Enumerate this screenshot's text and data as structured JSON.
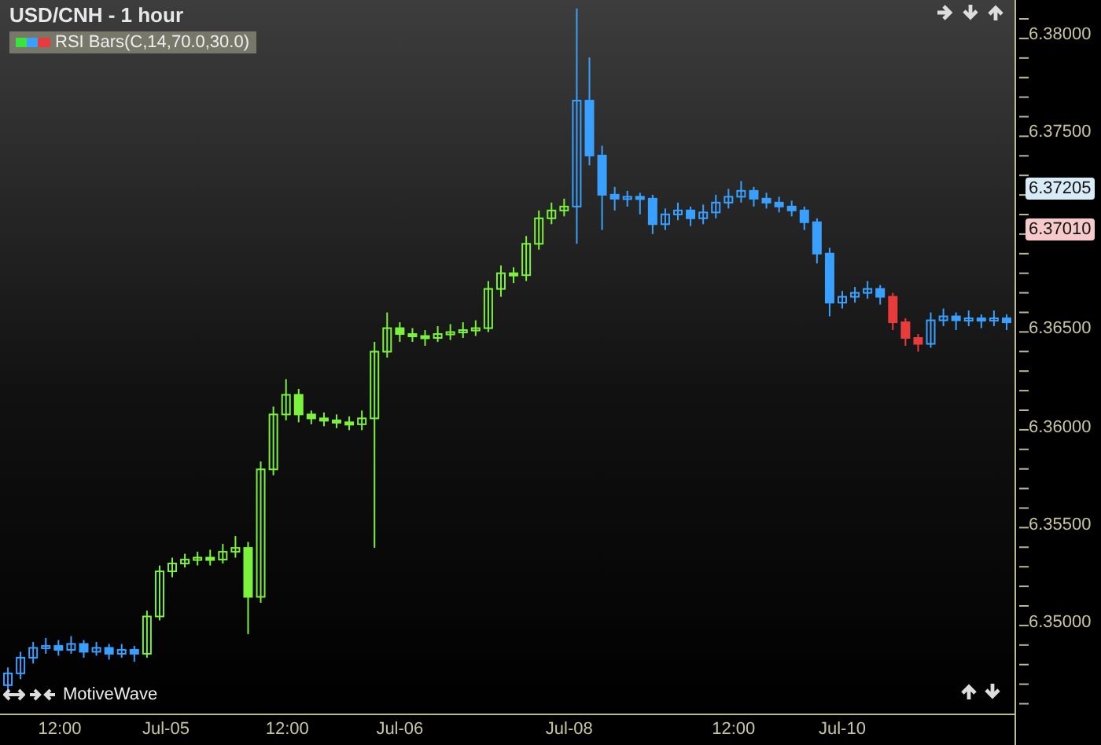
{
  "chart": {
    "title": "USD/CNH - 1 hour",
    "indicator": "RSI Bars(C,14,70.0,30.0)",
    "brand": "MotiveWave",
    "chart_data": {
      "type": "candlestick",
      "categories": [
        null,
        null,
        null,
        null,
        null,
        null,
        null,
        null,
        null,
        null,
        null,
        null,
        null,
        null,
        null,
        null,
        null,
        null,
        null,
        null,
        null,
        null,
        null,
        null,
        null,
        null,
        null,
        null,
        null,
        null,
        null,
        null,
        null,
        null,
        null,
        null,
        null,
        null,
        null,
        null,
        null,
        null,
        null,
        null,
        null,
        null,
        null,
        null,
        null,
        null,
        null,
        null,
        null,
        null,
        null,
        null,
        null,
        null,
        null,
        null,
        null,
        null,
        null,
        null,
        null,
        null,
        null,
        null,
        null,
        null,
        null,
        null,
        null,
        null,
        null,
        null,
        null,
        null,
        null,
        null
      ],
      "series": [
        {
          "color": "#3aa0ff",
          "ohlc": [
            [
              6.347,
              6.3479,
              6.3465,
              6.3476
            ],
            [
              6.3476,
              6.3487,
              6.3473,
              6.3484
            ],
            [
              6.3484,
              6.3492,
              6.3481,
              6.3489
            ],
            [
              6.3489,
              6.3494,
              6.3486,
              6.349
            ],
            [
              6.349,
              6.3493,
              6.3485,
              6.3488
            ],
            [
              6.3488,
              6.3495,
              6.3486,
              6.3491
            ],
            [
              6.3491,
              6.3493,
              6.3484,
              6.3487
            ],
            [
              6.3487,
              6.3492,
              6.3485,
              6.3489
            ],
            [
              6.3489,
              6.3491,
              6.3483,
              6.3486
            ],
            [
              6.3486,
              6.3491,
              6.3484,
              6.3488
            ],
            [
              6.3488,
              6.349,
              6.3482,
              6.3486
            ],
            null,
            null,
            null,
            null,
            null,
            null,
            null,
            null,
            null,
            null,
            null,
            null,
            null,
            null,
            null,
            null,
            null,
            null,
            null,
            null,
            null,
            null,
            null,
            null,
            null,
            null,
            null,
            null,
            null,
            null,
            null,
            null,
            null,
            null,
            [
              6.3714,
              6.3815,
              6.3695,
              6.3768
            ],
            [
              6.3768,
              6.379,
              6.3735,
              6.374
            ],
            [
              6.374,
              6.3745,
              6.3702,
              6.372
            ],
            [
              6.372,
              6.3724,
              6.3712,
              6.3718
            ],
            [
              6.3718,
              6.3722,
              6.3714,
              6.3719
            ],
            [
              6.3719,
              6.3721,
              6.371,
              6.3718
            ],
            [
              6.3718,
              6.372,
              6.37,
              6.3705
            ],
            [
              6.3705,
              6.3713,
              6.3702,
              6.371
            ],
            [
              6.371,
              6.3716,
              6.3707,
              6.3712
            ],
            [
              6.3712,
              6.3714,
              6.3704,
              6.3708
            ],
            [
              6.3708,
              6.3715,
              6.3705,
              6.3711
            ],
            [
              6.3711,
              6.372,
              6.3708,
              6.3716
            ],
            [
              6.3716,
              6.3723,
              6.3713,
              6.3719
            ],
            [
              6.3719,
              6.3727,
              6.3716,
              6.3722
            ],
            [
              6.3722,
              6.3724,
              6.3714,
              6.3718
            ],
            [
              6.3718,
              6.3721,
              6.3713,
              6.3716
            ],
            [
              6.3716,
              6.3719,
              6.3711,
              6.3714
            ],
            [
              6.3714,
              6.3717,
              6.3709,
              6.3712
            ],
            [
              6.3712,
              6.3714,
              6.3702,
              6.3706
            ],
            [
              6.3706,
              6.3708,
              6.3685,
              6.369
            ],
            [
              6.369,
              6.3693,
              6.3658,
              6.3665
            ],
            [
              6.3665,
              6.3671,
              6.3662,
              6.3668
            ],
            [
              6.3668,
              6.3673,
              6.3665,
              6.367
            ],
            [
              6.367,
              6.3676,
              6.3667,
              6.3672
            ],
            [
              6.3672,
              6.3674,
              6.3664,
              6.3668
            ],
            null,
            null,
            null,
            [
              6.3644,
              6.366,
              6.3642,
              6.3656
            ],
            [
              6.3656,
              6.3662,
              6.3653,
              6.3658
            ],
            [
              6.3658,
              6.366,
              6.3651,
              6.3656
            ],
            [
              6.3656,
              6.3661,
              6.3653,
              6.3657
            ],
            [
              6.3657,
              6.3659,
              6.3652,
              6.3656
            ],
            [
              6.3656,
              6.3661,
              6.3653,
              6.3657
            ],
            [
              6.3657,
              6.3659,
              6.3651,
              6.3655
            ]
          ]
        },
        {
          "color": "#7cf23c",
          "ohlc": [
            null,
            null,
            null,
            null,
            null,
            null,
            null,
            null,
            null,
            null,
            null,
            [
              6.3486,
              6.3508,
              6.3484,
              6.3505
            ],
            [
              6.3505,
              6.3531,
              6.3503,
              6.3528
            ],
            [
              6.3528,
              6.3535,
              6.3525,
              6.3532
            ],
            [
              6.3532,
              6.3537,
              6.353,
              6.3534
            ],
            [
              6.3534,
              6.3538,
              6.3531,
              6.3535
            ],
            [
              6.3535,
              6.3539,
              6.3531,
              6.3534
            ],
            [
              6.3534,
              6.3542,
              6.3532,
              6.3538
            ],
            [
              6.3538,
              6.3546,
              6.3535,
              6.354
            ],
            [
              6.354,
              6.3543,
              6.3496,
              6.3515
            ],
            [
              6.3515,
              6.3584,
              6.3512,
              6.358
            ],
            [
              6.358,
              6.3612,
              6.3577,
              6.3608
            ],
            [
              6.3608,
              6.3626,
              6.3605,
              6.3618
            ],
            [
              6.3618,
              6.3621,
              6.3604,
              6.3608
            ],
            [
              6.3608,
              6.361,
              6.3603,
              6.3606
            ],
            [
              6.3606,
              6.3609,
              6.3602,
              6.3605
            ],
            [
              6.3605,
              6.3608,
              6.3601,
              6.3604
            ],
            [
              6.3604,
              6.3607,
              6.36,
              6.3603
            ],
            [
              6.3603,
              6.361,
              6.36,
              6.3606
            ],
            [
              6.3606,
              6.3645,
              6.354,
              6.364
            ],
            [
              6.364,
              6.366,
              6.3637,
              6.3652
            ],
            [
              6.3652,
              6.3655,
              6.3645,
              6.3649
            ],
            [
              6.3649,
              6.3652,
              6.3645,
              6.3648
            ],
            [
              6.3648,
              6.3651,
              6.3643,
              6.3647
            ],
            [
              6.3647,
              6.3653,
              6.3645,
              6.3649
            ],
            [
              6.3649,
              6.3654,
              6.3646,
              6.365
            ],
            [
              6.365,
              6.3655,
              6.3647,
              6.3651
            ],
            [
              6.3651,
              6.3656,
              6.3648,
              6.3652
            ],
            [
              6.3652,
              6.3676,
              6.365,
              6.3672
            ],
            [
              6.3672,
              6.3684,
              6.3668,
              6.368
            ],
            [
              6.368,
              6.3683,
              6.3675,
              6.3679
            ],
            [
              6.3679,
              6.3699,
              6.3676,
              6.3695
            ],
            [
              6.3695,
              6.3712,
              6.3692,
              6.3708
            ],
            [
              6.3708,
              6.3716,
              6.3705,
              6.3712
            ],
            [
              6.3712,
              6.3718,
              6.3709,
              6.3714
            ],
            null,
            null,
            null,
            null,
            null,
            null,
            null,
            null,
            null,
            null,
            null,
            null,
            null,
            null,
            null,
            null,
            null,
            null,
            null,
            null,
            null,
            null,
            null,
            null,
            null,
            null,
            null,
            null,
            null,
            null,
            null,
            null,
            null,
            null,
            null
          ]
        },
        {
          "color": "#e83c3c",
          "ohlc": [
            null,
            null,
            null,
            null,
            null,
            null,
            null,
            null,
            null,
            null,
            null,
            null,
            null,
            null,
            null,
            null,
            null,
            null,
            null,
            null,
            null,
            null,
            null,
            null,
            null,
            null,
            null,
            null,
            null,
            null,
            null,
            null,
            null,
            null,
            null,
            null,
            null,
            null,
            null,
            null,
            null,
            null,
            null,
            null,
            null,
            null,
            null,
            null,
            null,
            null,
            null,
            null,
            null,
            null,
            null,
            null,
            null,
            null,
            null,
            null,
            null,
            null,
            null,
            null,
            null,
            null,
            null,
            null,
            null,
            null,
            [
              6.3668,
              6.367,
              6.3651,
              6.3655
            ],
            [
              6.3655,
              6.3657,
              6.3643,
              6.3647
            ],
            [
              6.3647,
              6.3649,
              6.364,
              6.3644
            ],
            null,
            null,
            null,
            null,
            null,
            null,
            null
          ]
        }
      ],
      "ylim": [
        6.34555,
        6.38193
      ],
      "yticks": [
        {
          "value": 6.38,
          "label": "6.38000"
        },
        {
          "value": 6.375,
          "label": "6.37500"
        },
        {
          "value": 6.365,
          "label": "6.36500"
        },
        {
          "value": 6.36,
          "label": "6.36000"
        },
        {
          "value": 6.355,
          "label": "6.35500"
        },
        {
          "value": 6.35,
          "label": "6.35000"
        }
      ]
    }
  },
  "x_axis": {
    "labels": [
      "12:00",
      "Jul-05",
      "12:00",
      "Jul-06",
      "Jul-08",
      "12:00",
      "Jul-10"
    ]
  },
  "price_tags": [
    {
      "label": "6.37205",
      "color": "#d8ecf8"
    },
    {
      "label": "6.37010",
      "color": "#f6caca"
    }
  ]
}
